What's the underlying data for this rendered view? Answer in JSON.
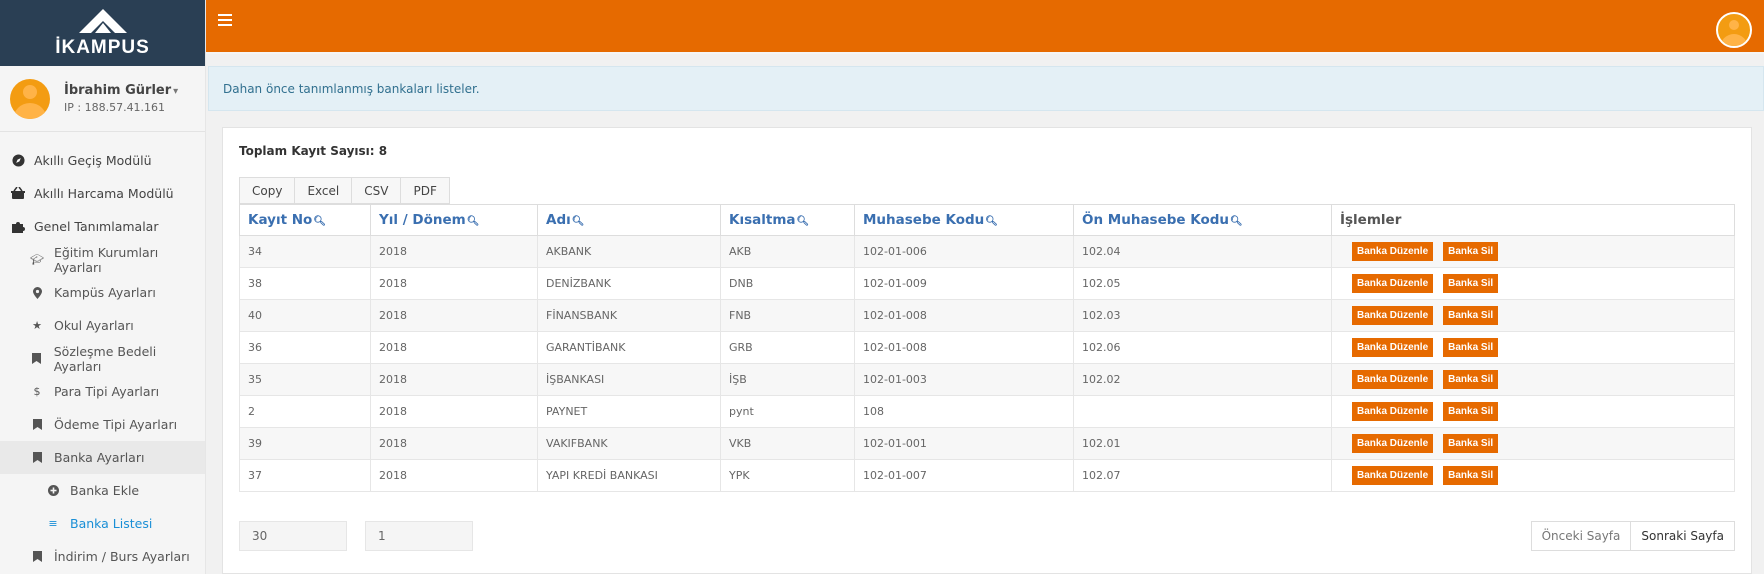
{
  "brand": {
    "name": "İKAMPUS"
  },
  "user": {
    "name": "İbrahim Gürler",
    "ip": "IP : 188.57.41.161"
  },
  "sidebar": {
    "items": [
      {
        "label": "Akıllı Geçiş Modülü",
        "icon": "compass-icon"
      },
      {
        "label": "Akıllı Harcama Modülü",
        "icon": "basket-icon"
      },
      {
        "label": "Genel Tanımlamalar",
        "icon": "puzzle-icon"
      },
      {
        "label": "Eğitim Kurumları Ayarları",
        "icon": "graduation-cap-icon"
      },
      {
        "label": "Kampüs Ayarları",
        "icon": "map-marker-icon"
      },
      {
        "label": "Okul Ayarları",
        "icon": "star-icon"
      },
      {
        "label": "Sözleşme Bedeli Ayarları",
        "icon": "bookmark-icon"
      },
      {
        "label": "Para Tipi Ayarları",
        "icon": "dollar-icon"
      },
      {
        "label": "Ödeme Tipi Ayarları",
        "icon": "bookmark-icon"
      },
      {
        "label": "Banka Ayarları",
        "icon": "bookmark-icon"
      },
      {
        "label": "Banka Ekle",
        "icon": "plus-circle-icon"
      },
      {
        "label": "Banka Listesi",
        "icon": "list-icon"
      },
      {
        "label": "İndirim / Burs Ayarları",
        "icon": "bookmark-icon"
      }
    ]
  },
  "topbar": {
    "accent": "#e66a00"
  },
  "info": {
    "text": "Dahan önce tanımlanmış bankaları listeler."
  },
  "table": {
    "total_label": "Toplam Kayıt Sayısı: 8",
    "export_buttons": [
      "Copy",
      "Excel",
      "CSV",
      "PDF"
    ],
    "columns": [
      "Kayıt No",
      "Yıl / Dönem",
      "Adı",
      "Kısaltma",
      "Muhasebe Kodu",
      "Ön Muhasebe Kodu",
      "İşlemler"
    ],
    "edit_label": "Banka Düzenle",
    "delete_label": "Banka Sil",
    "rows": [
      [
        "34",
        "2018",
        "AKBANK",
        "AKB",
        "102-01-006",
        "102.04"
      ],
      [
        "38",
        "2018",
        "DENİZBANK",
        "DNB",
        "102-01-009",
        "102.05"
      ],
      [
        "40",
        "2018",
        "FİNANSBANK",
        "FNB",
        "102-01-008",
        "102.03"
      ],
      [
        "36",
        "2018",
        "GARANTİBANK",
        "GRB",
        "102-01-008",
        "102.06"
      ],
      [
        "35",
        "2018",
        "İŞBANKASI",
        "İŞB",
        "102-01-003",
        "102.02"
      ],
      [
        "2",
        "2018",
        "PAYNET",
        "pynt",
        "108",
        ""
      ],
      [
        "39",
        "2018",
        "VAKIFBANK",
        "VKB",
        "102-01-001",
        "102.01"
      ],
      [
        "37",
        "2018",
        "YAPI KREDİ BANKASI",
        "YPK",
        "102-01-007",
        "102.07"
      ]
    ]
  },
  "pager": {
    "page_size": "30",
    "page": "1",
    "prev_label": "Önceki Sayfa",
    "next_label": "Sonraki Sayfa"
  }
}
